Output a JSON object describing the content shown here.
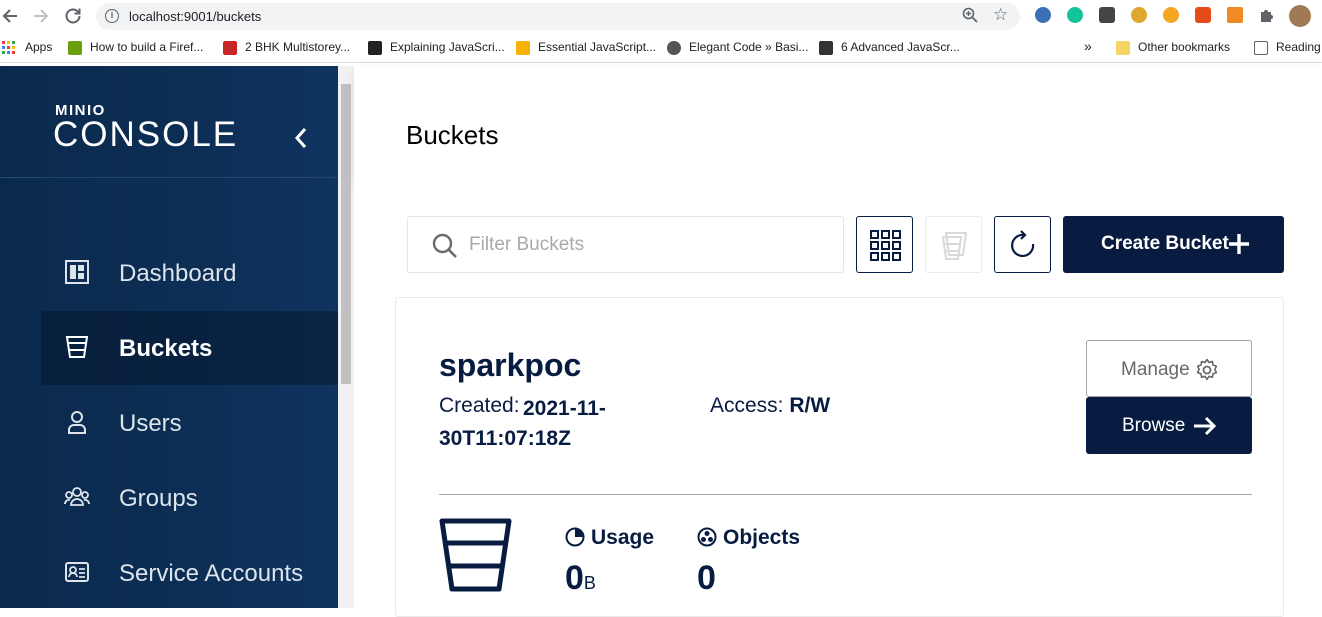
{
  "browser": {
    "url": "localhost:9001/buckets",
    "bookmarks": [
      {
        "label": "Apps",
        "color": "#e94235"
      },
      {
        "label": "How to build a Firef...",
        "color": "#6a9f0e"
      },
      {
        "label": "2 BHK Multistorey...",
        "color": "#c62828"
      },
      {
        "label": "Explaining JavaScri...",
        "color": "#222222"
      },
      {
        "label": "Essential JavaScript...",
        "color": "#f4b400"
      },
      {
        "label": "Elegant Code » Basi...",
        "color": "#555555"
      },
      {
        "label": "6 Advanced JavaScr...",
        "color": "#333333"
      }
    ],
    "overflow": "»",
    "other_bookmarks": "Other bookmarks",
    "reading_list": "Reading"
  },
  "sidebar": {
    "logo_small": "MINIO",
    "logo_big": "CONSOLE",
    "collapse_icon": "chevron-left-icon",
    "items": [
      {
        "label": "Dashboard",
        "icon": "dashboard-icon",
        "active": false
      },
      {
        "label": "Buckets",
        "icon": "bucket-icon",
        "active": true
      },
      {
        "label": "Users",
        "icon": "user-icon",
        "active": false
      },
      {
        "label": "Groups",
        "icon": "groups-icon",
        "active": false
      },
      {
        "label": "Service Accounts",
        "icon": "service-accounts-icon",
        "active": false
      }
    ]
  },
  "header": {
    "title": "Buckets"
  },
  "toolbar": {
    "search_placeholder": "Filter Buckets",
    "create_label": "Create Bucket"
  },
  "bucket": {
    "name": "sparkpoc",
    "created_label": "Created:",
    "created_value": "2021-11-30T11:07:18Z",
    "access_label": "Access:",
    "access_value": "R/W",
    "manage_label": "Manage",
    "browse_label": "Browse",
    "usage_label": "Usage",
    "usage_value": "0",
    "usage_unit": "B",
    "objects_label": "Objects",
    "objects_value": "0"
  },
  "colors": {
    "primary": "#081c42",
    "sidebar": "#0d2e55"
  }
}
